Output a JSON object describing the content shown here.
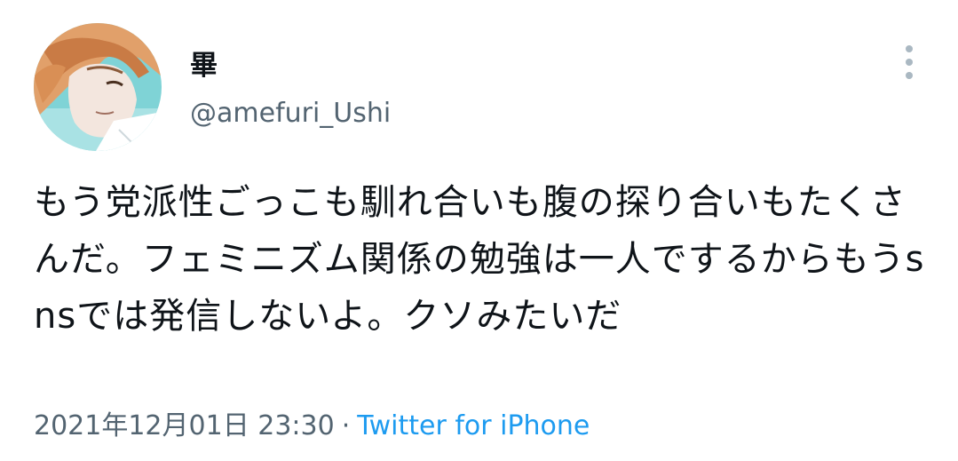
{
  "user": {
    "display_name": "畢",
    "handle": "@amefuri_Ushi",
    "avatar": "illustrated-portrait-avatar"
  },
  "tweet": {
    "text": "もう党派性ごっこも馴れ合いも腹の探り合いもたくさんだ。フェミニズム関係の勉強は一人でするからもうsnsでは発信しないよ。クソみたいだ",
    "timestamp": "2021年12月01日 23:30",
    "separator": "·",
    "source": "Twitter for iPhone"
  },
  "icons": {
    "more": "vertical-ellipsis-icon"
  },
  "colors": {
    "text": "#0f1419",
    "secondary": "#536471",
    "link": "#1d9bf0",
    "more_icon": "#aab8c2"
  }
}
